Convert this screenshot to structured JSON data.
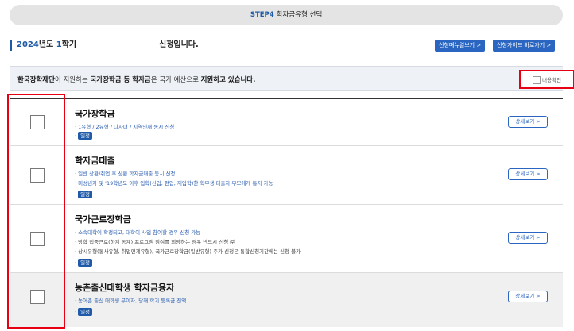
{
  "step_bar": {
    "step": "STEP4",
    "title": "학자금유형 선택"
  },
  "term": {
    "year": "2024",
    "year_suffix": "년도 ",
    "semester_num": "1",
    "semester_suffix": "학기"
  },
  "apply_text": "신청입니다.",
  "buttons": {
    "manual": "신청매뉴얼보기 >",
    "guide": "신청가이드 바로가기 >"
  },
  "notice": {
    "part1": "한국장학재단",
    "part2": "이 지원하는 ",
    "part3": "국가장학금 등 학자금",
    "part4": "은 국가 예산으로 ",
    "part5": "지원하고 있습니다.",
    "confirm_label": "내용확인"
  },
  "rows": [
    {
      "title": "국가장학금",
      "lines": [
        "· 1유형 / 2유형 / 다자녀 / 지역인재 동시 신청"
      ],
      "badge_prefix": "·",
      "badge": "일정",
      "detail": "상세보기 >"
    },
    {
      "title": "학자금대출",
      "lines": [
        "· 일반 상환/취업 후 상환 학자금대출 동시 신청",
        "· 미성년자 및 '19학년도 이후 입학(신입, 편입, 재입학)한 학부생 대출자 부모에게 통지 가능"
      ],
      "badge_prefix": "·",
      "badge": "일정",
      "detail": "상세보기 >"
    },
    {
      "title": "국가근로장학금",
      "lines": [
        "· 소속대학이 확정되고, 대학이 사업 참여할 경우 신청 가능",
        "· 방학 집중근로(하계 동계) 프로그램 참여를 희망하는 경우 반드시 신청 ㈜",
        "· 상시유형(통사유형, 취업연계유형), 국가근로장학금(일반유형) 주가 신청은 통합신청기간에는 신청 불가"
      ],
      "badge_prefix": "·",
      "badge": "일정",
      "detail": "상세보기 >"
    },
    {
      "title": "농촌출신대학생 학자금융자",
      "lines": [
        "· 농어촌 출신 대학생 무이자, 당해 학기 등록금 전액"
      ],
      "badge_prefix": "·",
      "badge": "일정",
      "detail": "상세보기 >"
    }
  ]
}
